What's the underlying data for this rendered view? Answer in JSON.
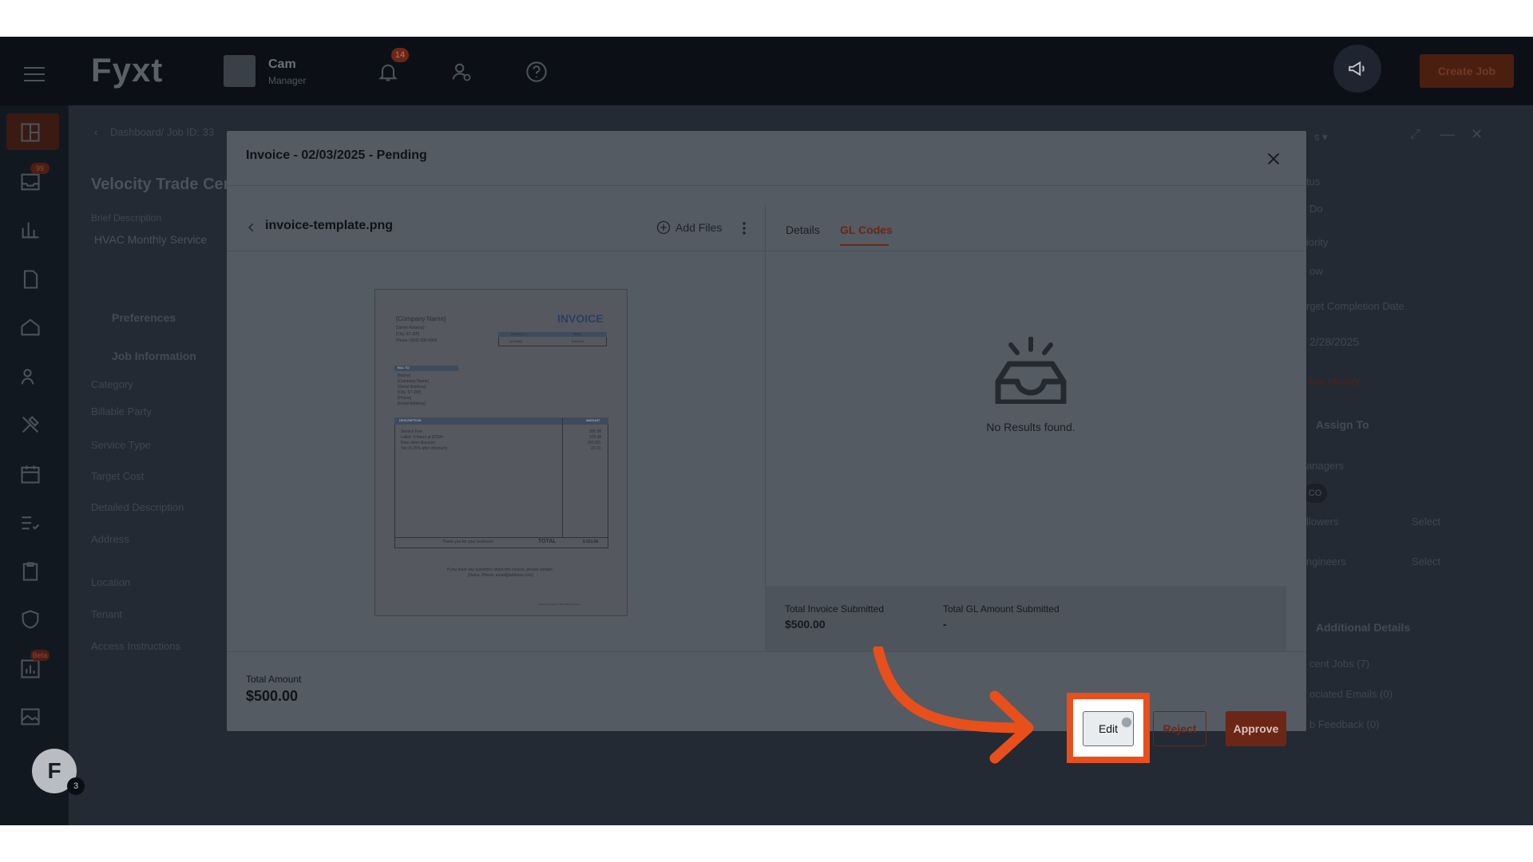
{
  "colors": {
    "accent": "#6b2616",
    "highlight": "#e94f1b",
    "overlay_bg": "#232a33"
  },
  "app": {
    "logo": "Fyxt",
    "org_name": "Cam",
    "org_role": "Manager",
    "notifications_count": "14",
    "create_job_label": "Create Job"
  },
  "nav": {
    "badges": [
      "99",
      "Beta"
    ],
    "avatar_initial": "F",
    "avatar_count": "3",
    "icons": [
      "dashboard-icon",
      "inbox-icon",
      "chart-icon",
      "document-icon",
      "home-icon",
      "people-icon",
      "tools-icon",
      "calendar-icon",
      "checklist-icon",
      "clipboard-icon",
      "shield-icon",
      "reports-icon",
      "gallery-icon"
    ]
  },
  "background": {
    "breadcrumb": "Dashboard/ Job ID: 33",
    "title": "Velocity Trade Cen",
    "brief_label": "Brief Description",
    "brief_value": "HVAC Monthly Service",
    "preferences": "Preferences",
    "job_information": "Job Information",
    "fields": [
      "Category",
      "Billable Party",
      "Service Type",
      "Target Cost",
      "Detailed Description",
      "Address",
      "Location",
      "Tenant",
      "Access Instructions"
    ],
    "right_labels": [
      "tus",
      "Do",
      "iority",
      "ow",
      "rget Completion Date"
    ],
    "date_value": "2/28/2025",
    "view_history": "iew History",
    "assign_to": "Assign To",
    "managers": "anagers",
    "manager_initials": "CO",
    "followers": "llowers",
    "engineers": "ngineers",
    "select": "Select",
    "additional_details": "Additional Details",
    "recent_jobs": "cent Jobs (7)",
    "associated_emails": "ociated Emails (0)",
    "feedback": "b Feedback (0)",
    "filter": "s ▾"
  },
  "modal": {
    "title": "Invoice - 02/03/2025 - Pending",
    "file_name": "invoice-template.png",
    "add_files": "Add Files",
    "tabs": [
      {
        "label": "Details",
        "active": false
      },
      {
        "label": "GL Codes",
        "active": true
      }
    ],
    "empty_text": "No Results found.",
    "total_invoice_label": "Total Invoice Submitted",
    "total_invoice_value": "$500.00",
    "total_gl_label": "Total GL Amount Submitted",
    "total_gl_value": "-",
    "total_amount_label": "Total Amount",
    "total_amount_value": "$500.00",
    "buttons": {
      "edit": "Edit",
      "reject": "Reject",
      "approve": "Approve"
    }
  },
  "invoice_preview": {
    "title": "INVOICE",
    "company": "[Company Name]",
    "address_lines": [
      "[Street Address]",
      "[City, ST ZIP]",
      "Phone: (000) 000-0000"
    ],
    "bill_to": "BILL TO",
    "bill_lines": [
      "[Name]",
      "[Company Name]",
      "[Street Address]",
      "[City, ST ZIP]",
      "[Phone]",
      "[Email Address]"
    ],
    "meta_headers": [
      "INVOICE #",
      "DATE"
    ],
    "meta_values": [
      "[123456]",
      "8/1/2014"
    ],
    "col_description": "DESCRIPTION",
    "col_amount": "AMOUNT",
    "items": [
      "Service Fee",
      "Labor: 5 hours at $75/hr",
      "New client discount",
      "Tax (4.25% after discount)"
    ],
    "amounts": [
      "200.00",
      "375.00",
      "(50.00)",
      "22.31"
    ],
    "thank_you": "Thank you for your business!",
    "total_label": "TOTAL",
    "total_value": "$ 551.56",
    "footer1": "If you have any questions about this invoice, please contact",
    "footer2": "[Name, Phone, email@address.com]",
    "footnote": "Invoice Template © 2014 Vertex42.com"
  }
}
